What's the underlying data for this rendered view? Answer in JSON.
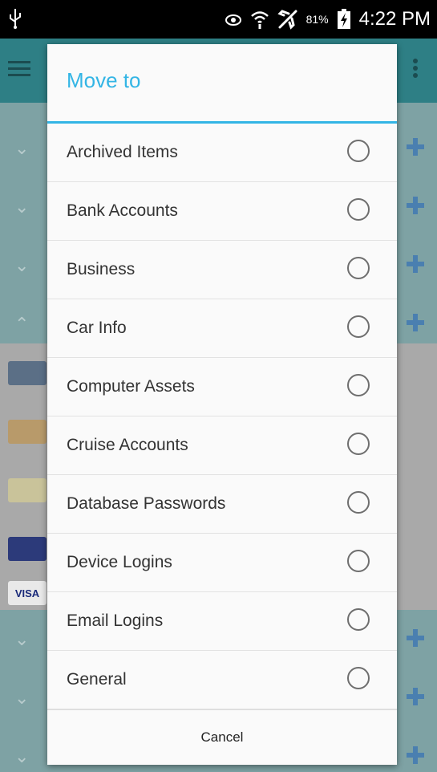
{
  "status_bar": {
    "battery_percent": "81%",
    "time": "4:22 PM",
    "icons": [
      "usb-icon",
      "eye-icon",
      "wifi-icon",
      "airplane-icon",
      "battery-charging-icon"
    ]
  },
  "dialog": {
    "title": "Move to",
    "items": [
      {
        "label": "Archived Items"
      },
      {
        "label": "Bank Accounts"
      },
      {
        "label": "Business"
      },
      {
        "label": "Car Info"
      },
      {
        "label": "Computer Assets"
      },
      {
        "label": "Cruise Accounts"
      },
      {
        "label": "Database Passwords"
      },
      {
        "label": "Device Logins"
      },
      {
        "label": "Email Logins"
      },
      {
        "label": "General"
      }
    ],
    "cancel_label": "Cancel"
  },
  "background": {
    "card_labels": [
      "VISA"
    ]
  },
  "colors": {
    "accent": "#33b5e5",
    "action_bar": "#2e7f85"
  }
}
